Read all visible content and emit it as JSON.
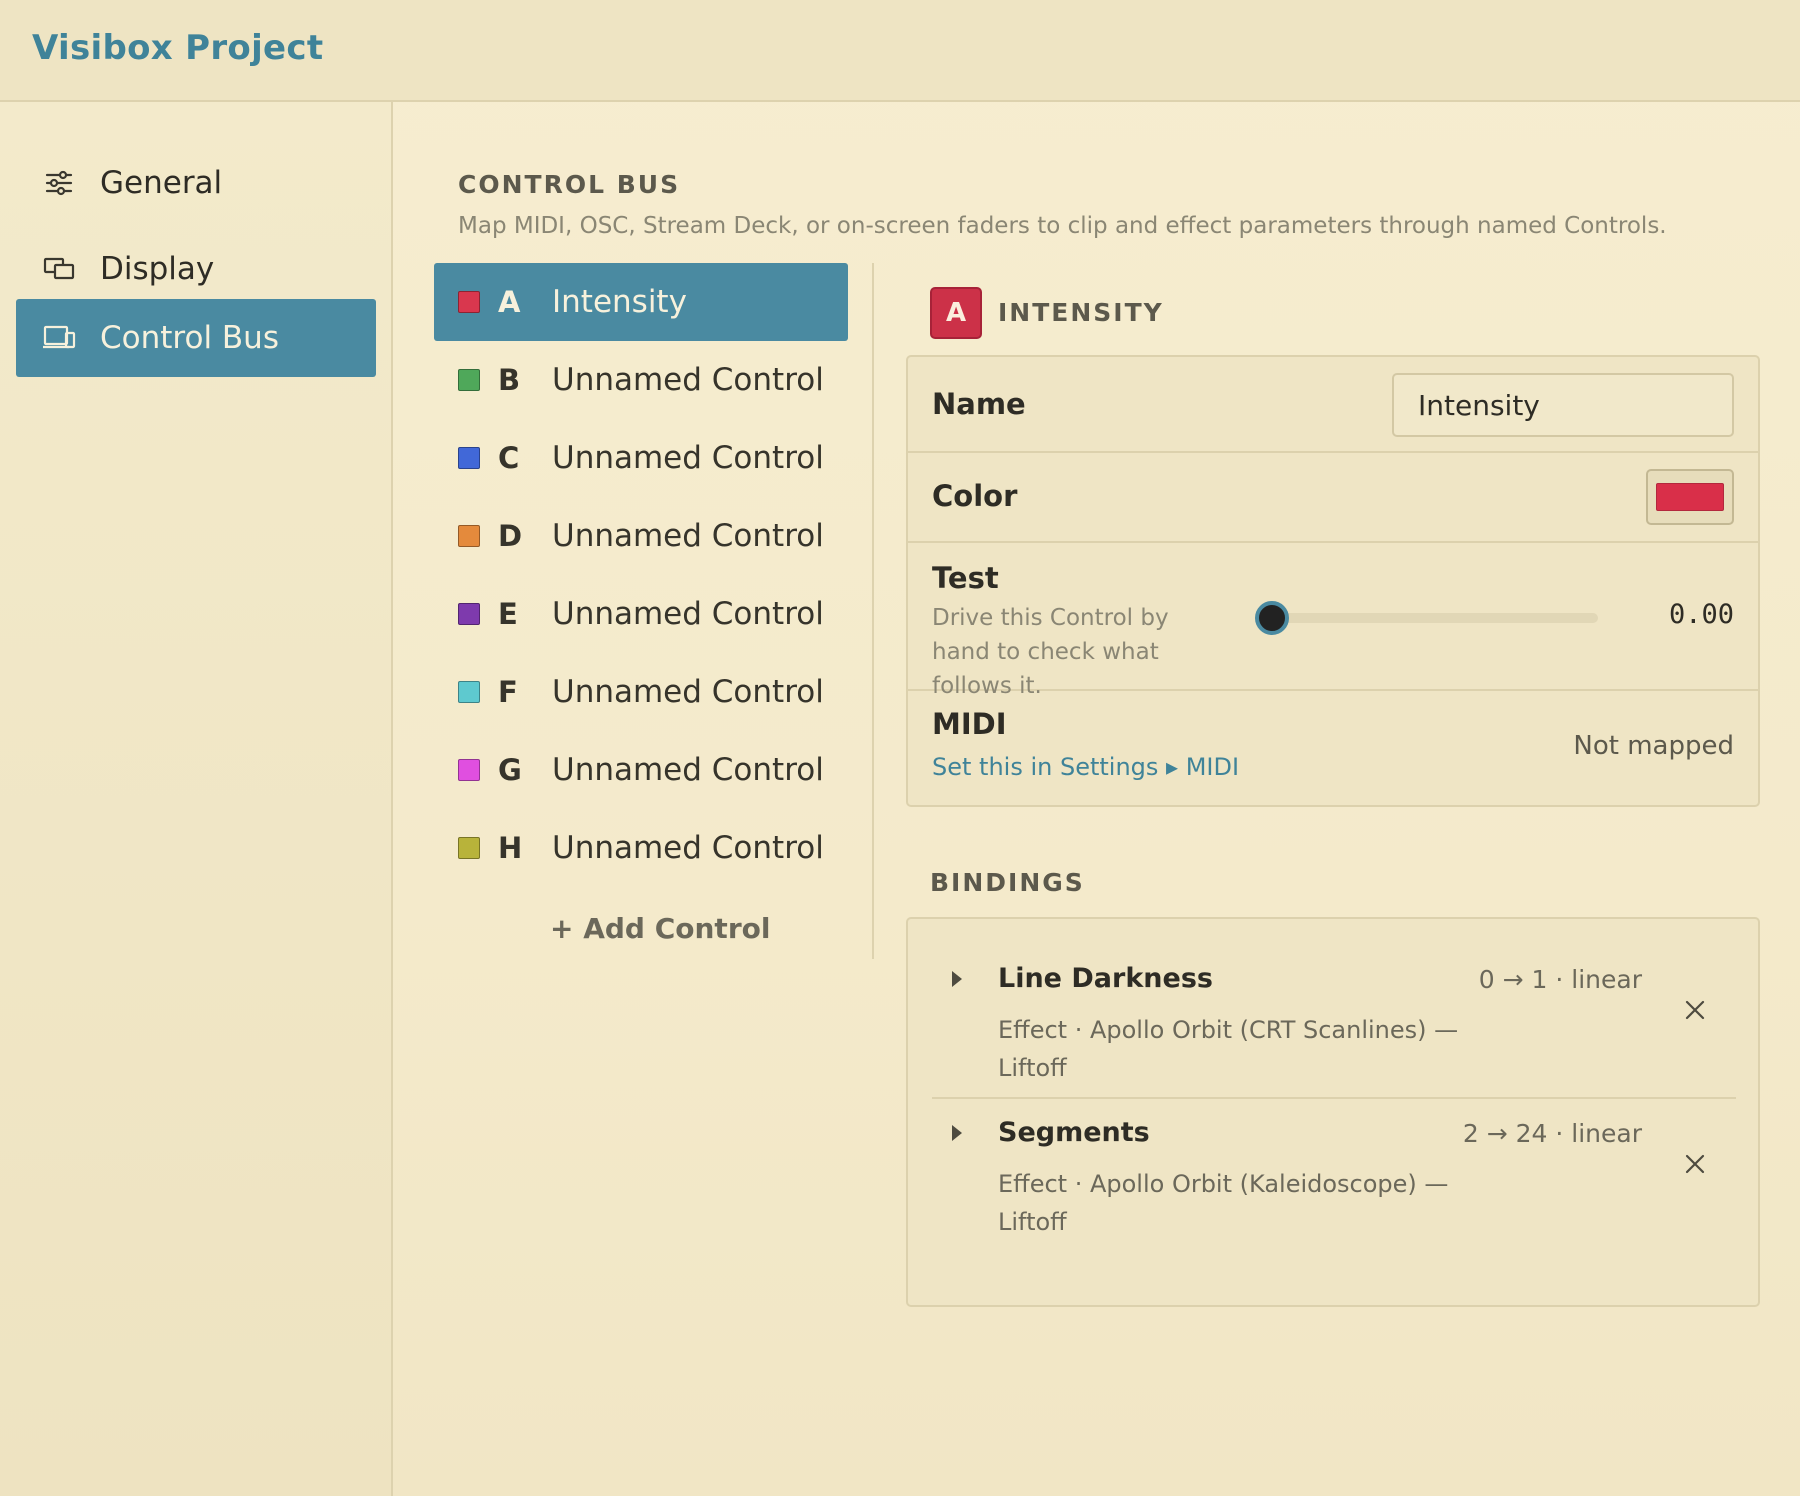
{
  "app": {
    "title": "Visibox Project"
  },
  "sidebar": {
    "items": [
      {
        "label": "General",
        "icon": "sliders-icon",
        "active": false
      },
      {
        "label": "Display",
        "icon": "display-icon",
        "active": false
      },
      {
        "label": "Control Bus",
        "icon": "control-bus-icon",
        "active": true
      }
    ]
  },
  "section": {
    "title": "CONTROL BUS",
    "description": "Map MIDI, OSC, Stream Deck, or on-screen faders to clip and effect parameters through named Controls."
  },
  "controls": [
    {
      "letter": "A",
      "name": "Intensity",
      "color": "#d9374e",
      "active": true
    },
    {
      "letter": "B",
      "name": "Unnamed Control",
      "color": "#4fa85a",
      "active": false
    },
    {
      "letter": "C",
      "name": "Unnamed Control",
      "color": "#4168d8",
      "active": false
    },
    {
      "letter": "D",
      "name": "Unnamed Control",
      "color": "#e48a3c",
      "active": false
    },
    {
      "letter": "E",
      "name": "Unnamed Control",
      "color": "#7e3aad",
      "active": false
    },
    {
      "letter": "F",
      "name": "Unnamed Control",
      "color": "#5ec9cf",
      "active": false
    },
    {
      "letter": "G",
      "name": "Unnamed Control",
      "color": "#e04fe0",
      "active": false
    },
    {
      "letter": "H",
      "name": "Unnamed Control",
      "color": "#b8b33a",
      "active": false
    }
  ],
  "add_control_label": "+ Add Control",
  "detail": {
    "badge": "A",
    "title": "INTENSITY",
    "name_label": "Name",
    "name_value": "Intensity",
    "color_label": "Color",
    "color_value": "#d92f49",
    "test_label": "Test",
    "test_hint": "Drive this Control by hand to check what follows it.",
    "test_value": "0.00",
    "test_level": 0,
    "midi_label": "MIDI",
    "midi_link": "Set this in Settings ▸ MIDI",
    "midi_status": "Not mapped"
  },
  "bindings": {
    "title": "BINDINGS",
    "items": [
      {
        "name": "Line Darkness",
        "range": "0 → 1 · linear",
        "target": "Effect · Apollo Orbit (CRT Scanlines) — Liftoff"
      },
      {
        "name": "Segments",
        "range": "2 → 24 · linear",
        "target": "Effect · Apollo Orbit (Kaleidoscope) — Liftoff"
      }
    ]
  },
  "colors": {
    "accent": "#4a8aa1",
    "title": "#3f8399",
    "background": "#f5ecce"
  }
}
